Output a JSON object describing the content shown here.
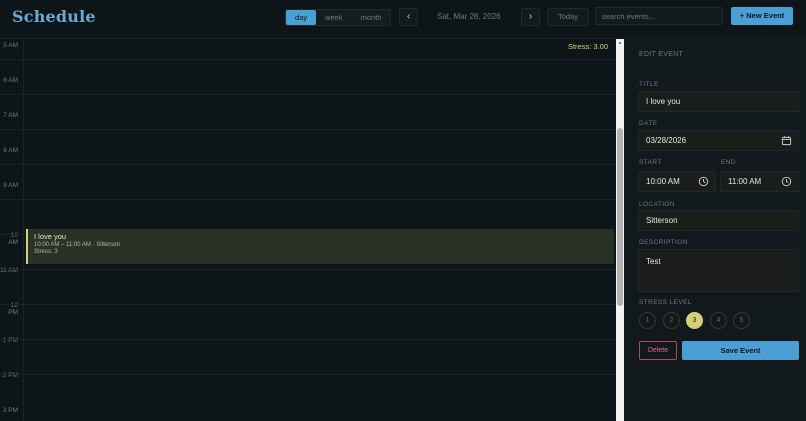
{
  "app": {
    "title": "Schedule"
  },
  "header": {
    "views": [
      "day",
      "week",
      "month"
    ],
    "active_view": "day",
    "prev_label": "‹",
    "next_label": "›",
    "date_label": "Sat, Mar 28, 2026",
    "today_label": "Today",
    "search_placeholder": "search events...",
    "new_event_label": "+ New Event"
  },
  "calendar": {
    "stress_summary": "Stress: 3.00",
    "hours": [
      "5 AM",
      "6 AM",
      "7 AM",
      "8 AM",
      "9 AM",
      "10 AM",
      "11 AM",
      "12 PM",
      "1 PM",
      "2 PM",
      "3 PM"
    ],
    "event": {
      "title": "I love you",
      "time_location": "10:00 AM – 11:00 AM · Sitterson",
      "stress": "Stress: 3"
    }
  },
  "edit_panel": {
    "heading": "EDIT EVENT",
    "title_label": "TITLE",
    "title_value": "I love you",
    "date_label": "DATE",
    "date_value": "03/28/2026",
    "start_label": "START",
    "start_value": "10:00 AM",
    "end_label": "END",
    "end_value": "11:00 AM",
    "location_label": "LOCATION",
    "location_value": "Sitterson",
    "description_label": "DESCRIPTION",
    "description_value": "Test",
    "stress_label": "STRESS LEVEL",
    "stress_options": [
      "1",
      "2",
      "3",
      "4",
      "5"
    ],
    "stress_selected": "3",
    "delete_label": "Delete",
    "save_label": "Save Event"
  },
  "colors": {
    "accent": "#4a9fd4",
    "stress": "#d6cf7a",
    "danger": "#d9707f",
    "background": "#0e1519"
  }
}
